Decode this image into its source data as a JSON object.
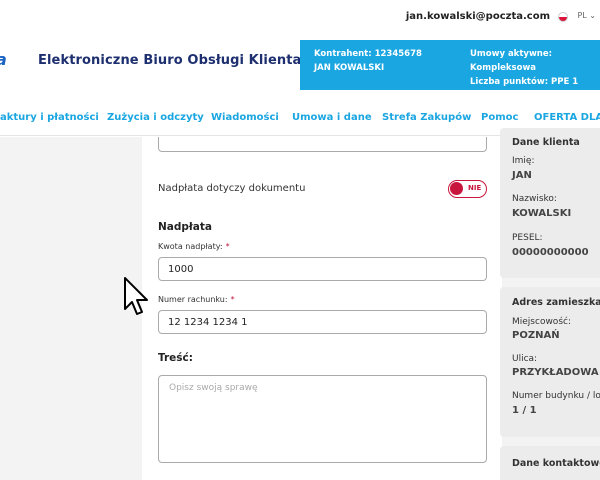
{
  "topbar": {
    "email": "jan.kowalski@poczta.com",
    "lang": "PL ⌄"
  },
  "header": {
    "logo_fragment": "a",
    "title": "Elektroniczne Biuro Obsługi Klienta",
    "contractor_label": "Kontrahent: 12345678",
    "contractor_name": "JAN KOWALSKI",
    "contracts_label": "Umowy aktywne:",
    "contracts_value": "Kompleksowa",
    "points_label": "Liczba punktów: PPE 1"
  },
  "nav": {
    "items": [
      "aktury i płatności",
      "Zużycia i odczyty",
      "Wiadomości",
      "Umowa i dane",
      "Strefa Zakupów",
      "Pomoc",
      "OFERTA DLA C"
    ]
  },
  "form": {
    "overpayment_doc_label": "Nadpłata dotyczy dokumentu",
    "toggle_text": "NIE",
    "section_title": "Nadpłata",
    "amount_label": "Kwota nadpłaty:",
    "amount_value": "1000",
    "account_label": "Numer rachunku:",
    "account_value": "12 1234 1234 1",
    "content_label": "Treść:",
    "content_placeholder": "Opisz swoją sprawę",
    "required_mark": "*"
  },
  "client": {
    "title": "Dane klienta",
    "first_name_label": "Imię:",
    "first_name": "JAN",
    "last_name_label": "Nazwisko:",
    "last_name": "KOWALSKI",
    "pesel_label": "PESEL:",
    "pesel": "00000000000"
  },
  "address": {
    "title": "Adres zamieszkan",
    "city_label": "Miejscowość:",
    "city": "POZNAŃ",
    "street_label": "Ulica:",
    "street": "PRZYKŁADOWA",
    "building_label": "Numer budynku / lok",
    "building": "1 / 1"
  },
  "contact": {
    "title": "Dane kontaktowe"
  },
  "colors": {
    "accent": "#1aa6e1",
    "navy": "#1d2f6f",
    "danger": "#c8163c"
  }
}
